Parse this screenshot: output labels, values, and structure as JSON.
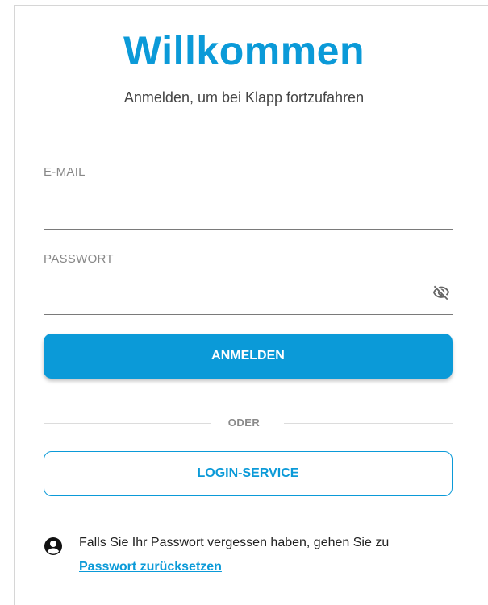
{
  "header": {
    "title": "Willkommen",
    "subtitle": "Anmelden, um bei Klapp fortzufahren"
  },
  "form": {
    "email_label": "E-MAIL",
    "email_value": "",
    "password_label": "PASSWORT",
    "password_value": "",
    "toggle_icon": "eye-off-icon",
    "submit_label": "ANMELDEN"
  },
  "divider": {
    "label": "ODER"
  },
  "login_service": {
    "label": "LOGIN-SERVICE"
  },
  "help": {
    "icon": "account-circle-icon",
    "text": "Falls Sie Ihr Passwort vergessen haben, gehen Sie zu",
    "link": "Passwort zurücksetzen"
  },
  "colors": {
    "accent": "#0b9ad8",
    "text": "#222222",
    "muted": "#888888"
  }
}
